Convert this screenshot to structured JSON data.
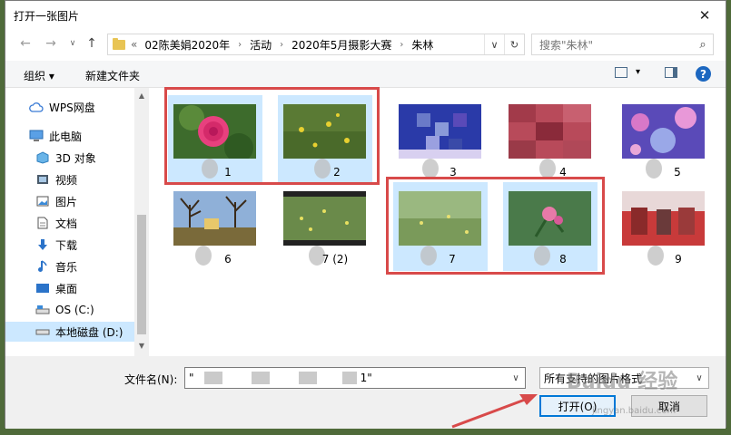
{
  "dialog": {
    "title": "打开一张图片",
    "close_glyph": "✕"
  },
  "nav": {
    "back": "←",
    "forward": "→",
    "recent": "∨",
    "up": "↑"
  },
  "address": {
    "overflow": "«",
    "crumbs": [
      "02陈美娟2020年",
      "活动",
      "2020年5月摄影大赛",
      "朱林"
    ],
    "separator": "›",
    "dropdown": "∨",
    "refresh": "↻"
  },
  "search": {
    "placeholder": "搜索\"朱林\"",
    "icon": "⌕"
  },
  "toolbar": {
    "organize": "组织 ▾",
    "new_folder": "新建文件夹",
    "view_dropdown": "▾",
    "help": "?"
  },
  "sidebar": {
    "items": [
      {
        "label": "WPS网盘",
        "icon": "cloud-icon"
      },
      {
        "label": "此电脑",
        "icon": "computer-icon"
      },
      {
        "label": "3D 对象",
        "icon": "cube-icon"
      },
      {
        "label": "视频",
        "icon": "video-icon"
      },
      {
        "label": "图片",
        "icon": "picture-icon"
      },
      {
        "label": "文档",
        "icon": "document-icon"
      },
      {
        "label": "下载",
        "icon": "download-icon"
      },
      {
        "label": "音乐",
        "icon": "music-icon"
      },
      {
        "label": "桌面",
        "icon": "desktop-icon"
      },
      {
        "label": "OS (C:)",
        "icon": "drive-icon"
      },
      {
        "label": "本地磁盘 (D:)",
        "icon": "drive-icon"
      }
    ],
    "scroll_up": "▲",
    "scroll_down": "▼"
  },
  "files": [
    {
      "label": "1",
      "selected": true
    },
    {
      "label": "2",
      "selected": true
    },
    {
      "label": "3",
      "selected": false
    },
    {
      "label": "4",
      "selected": false
    },
    {
      "label": "5",
      "selected": false
    },
    {
      "label": "6",
      "selected": false
    },
    {
      "label": "7 (2)",
      "selected": false
    },
    {
      "label": "7",
      "selected": true
    },
    {
      "label": "8",
      "selected": true
    },
    {
      "label": "9",
      "selected": false
    }
  ],
  "bottom": {
    "filename_label": "文件名(N):",
    "filename_value_start": "\"",
    "filename_value_end": "1\"",
    "filter_value": "所有支持的图片格式",
    "open_button": "打开(O)",
    "cancel_button": "取消",
    "dropdown": "∨"
  },
  "watermark": {
    "text": "Baidu 经验",
    "sub": "jingyan.baidu.com"
  },
  "colors": {
    "selection": "#cce8ff",
    "highlight_box": "#d84a4a",
    "primary_border": "#0078d7"
  }
}
